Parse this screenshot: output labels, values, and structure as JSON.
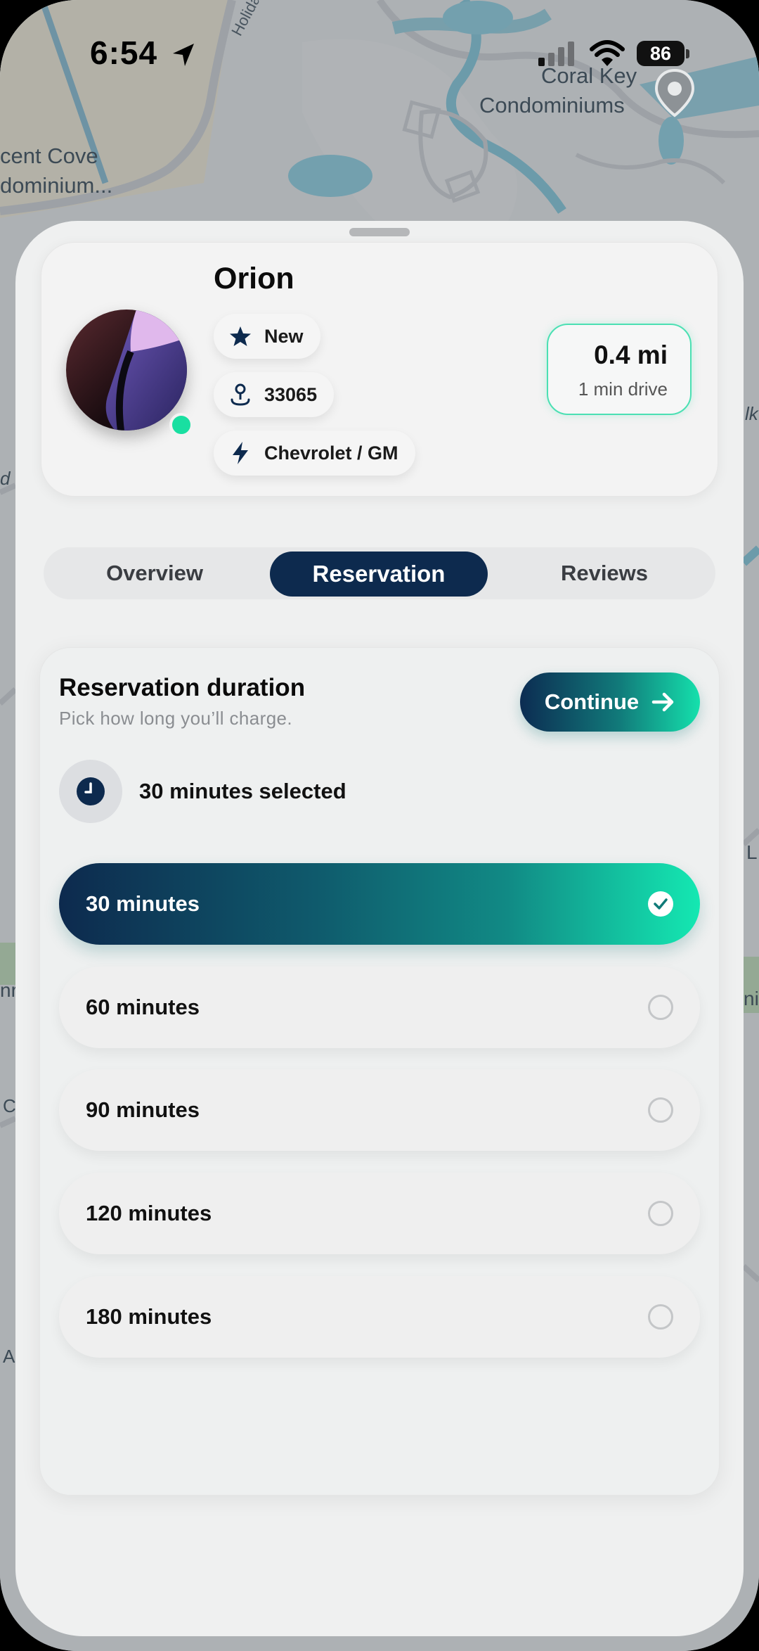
{
  "status_bar": {
    "time": "6:54",
    "battery": "86"
  },
  "map": {
    "labels": {
      "holiday_street": "Holiday Sp",
      "coral_key_line1": "Coral Key",
      "coral_key_line2": "Condominiums",
      "crescent_line1": "cent Cove",
      "crescent_line2": "dominium...",
      "edge_right_1": "lk",
      "edge_right_2": "L",
      "edge_right_3": "ni",
      "edge_left_1": "d",
      "edge_left_2": "nr",
      "edge_left_3": "C",
      "edge_left_4": "A"
    }
  },
  "station": {
    "name": "Orion",
    "chips": [
      {
        "icon": "star-icon",
        "label": "New"
      },
      {
        "icon": "location-pin-icon",
        "label": "33065"
      },
      {
        "icon": "lightning-bolt-icon",
        "label": "Chevrolet / GM"
      }
    ],
    "distance": "0.4 mi",
    "drive_time": "1 min drive"
  },
  "tabs": [
    {
      "label": "Overview",
      "active": false
    },
    {
      "label": "Reservation",
      "active": true
    },
    {
      "label": "Reviews",
      "active": false
    }
  ],
  "reservation": {
    "title": "Reservation duration",
    "subtitle": "Pick how long you’ll charge.",
    "continue_label": "Continue",
    "selected_text": "30 minutes selected",
    "options": [
      {
        "label": "30 minutes",
        "selected": true
      },
      {
        "label": "60 minutes",
        "selected": false
      },
      {
        "label": "90 minutes",
        "selected": false
      },
      {
        "label": "120 minutes",
        "selected": false
      },
      {
        "label": "180 minutes",
        "selected": false
      }
    ]
  },
  "colors": {
    "navy": "#0d2a4e",
    "teal_accent": "#14e8b2",
    "online_dot": "#19dfa1"
  }
}
